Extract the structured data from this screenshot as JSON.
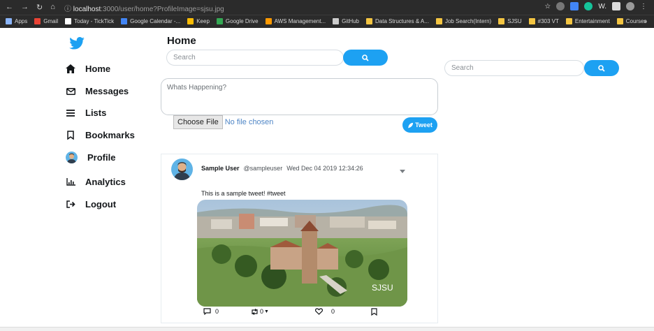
{
  "browser": {
    "url_host": "localhost",
    "url_path": ":3000/user/home?ProfileImage=sjsu.jpg",
    "bookmarks": [
      {
        "label": "Apps",
        "color": "#8ab4f8"
      },
      {
        "label": "Gmail",
        "color": "#ea4335"
      },
      {
        "label": "Today - TickTick",
        "color": "#ffffff"
      },
      {
        "label": "Google Calendar -...",
        "color": "#4285f4"
      },
      {
        "label": "Keep",
        "color": "#fbbc04"
      },
      {
        "label": "Google Drive",
        "color": "#34a853"
      },
      {
        "label": "AWS Management...",
        "color": "#ff9900"
      },
      {
        "label": "GitHub",
        "color": "#cccccc"
      },
      {
        "label": "Data Structures & A...",
        "color": "#f4c542"
      },
      {
        "label": "Job Search(Intern)",
        "color": "#f4c542"
      },
      {
        "label": "SJSU",
        "color": "#f4c542"
      },
      {
        "label": "#303 VT",
        "color": "#f4c542"
      },
      {
        "label": "Entertainment",
        "color": "#f4c542"
      },
      {
        "label": "Courses",
        "color": "#f4c542"
      }
    ],
    "more": "»",
    "ext_label": "W."
  },
  "sidebar": {
    "items": [
      {
        "label": "Home",
        "icon": "home-icon"
      },
      {
        "label": "Messages",
        "icon": "envelope-icon"
      },
      {
        "label": "Lists",
        "icon": "list-icon"
      },
      {
        "label": "Bookmarks",
        "icon": "bookmark-icon"
      },
      {
        "label": "Profile",
        "icon": "avatar-icon"
      },
      {
        "label": "Analytics",
        "icon": "chart-icon"
      },
      {
        "label": "Logout",
        "icon": "logout-icon"
      }
    ]
  },
  "main": {
    "title": "Home",
    "search_placeholder": "Search",
    "compose_placeholder": "Whats Happening?",
    "choose_file_label": "Choose File",
    "file_status": "No file chosen",
    "tweet_button": "Tweet"
  },
  "right": {
    "search_placeholder": "Search"
  },
  "tweet": {
    "user_name": "Sample User",
    "handle": "@sampleuser",
    "date": "Wed Dec 04 2019 12:34:26",
    "text": "This is a sample tweet! #tweet",
    "image_watermark": "SJSU",
    "reply_count": "0",
    "retweet_count": "0",
    "like_count": "0"
  },
  "colors": {
    "brand": "#1da1f2",
    "text": "#14171a"
  }
}
